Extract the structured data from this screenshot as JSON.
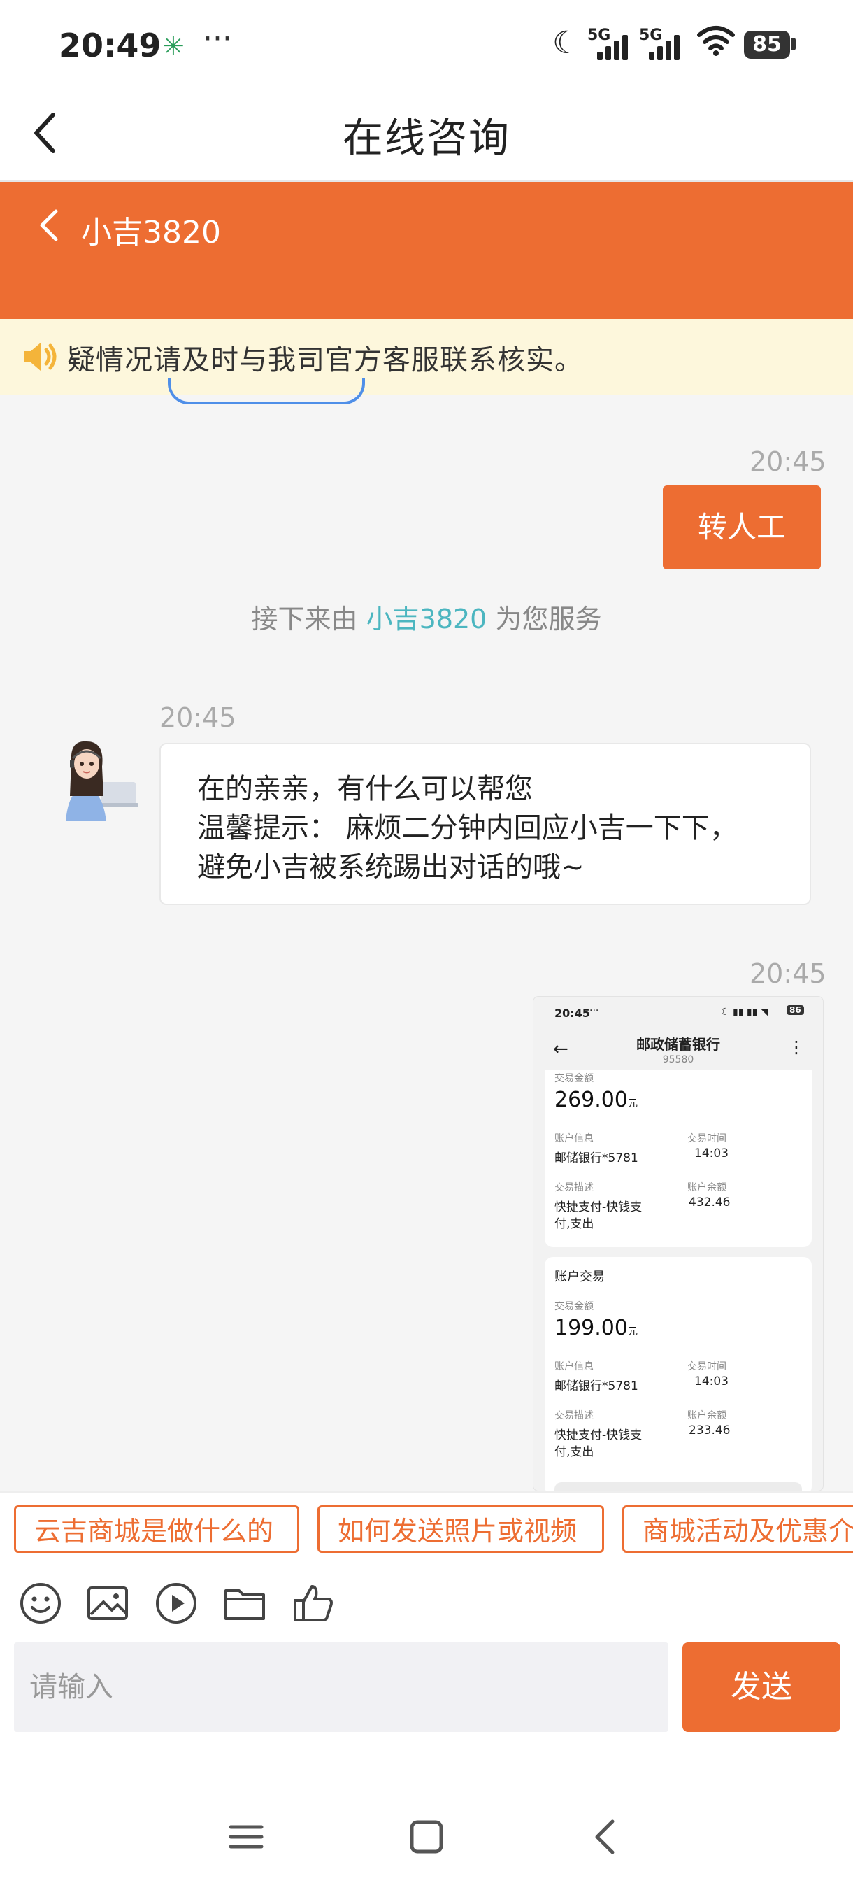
{
  "status_bar": {
    "time": "20:49",
    "notif_icon": "china-post-icon",
    "dots": "···",
    "signal_tags": [
      "5G",
      "5G"
    ],
    "battery": "85"
  },
  "title_bar": {
    "title": "在线咨询"
  },
  "chat_header": {
    "agent_name": "小吉3820"
  },
  "notice": {
    "text": "疑情况请及时与我司官方客服联系核实。"
  },
  "messages": {
    "m1_time": "20:45",
    "m1_text": "转人工",
    "system_prefix": "接下来由",
    "system_agent": "小吉3820",
    "system_suffix": "为您服务",
    "m2_time": "20:45",
    "m2_lines": [
      "在的亲亲，有什么可以帮您",
      "温馨提示： 麻烦二分钟内回应小吉一下下，",
      "避免小吉被系统踢出对话的哦~"
    ],
    "m3_time": "20:45"
  },
  "screenshot": {
    "time": "20:45",
    "dots": "···",
    "battery": "86",
    "bank": "邮政储蓄银行",
    "bank_number": "95580",
    "tx1": {
      "amount_label": "交易金额",
      "amount": "269.00",
      "unit": "元",
      "account_label": "账户信息",
      "account": "邮储银行*5781",
      "time_label": "交易时间",
      "time": "14:03",
      "desc_label": "交易描述",
      "desc_1": "快捷支付-快钱支",
      "desc_2": "付,支出",
      "balance_label": "账户余额",
      "balance": "432.46"
    },
    "tx2": {
      "header": "账户交易",
      "amount_label": "交易金额",
      "amount": "199.00",
      "unit": "元",
      "account_label": "账户信息",
      "account": "邮储银行*5781",
      "time_label": "交易时间",
      "time": "14:03",
      "desc_label": "交易描述",
      "desc_1": "快捷支付-快钱支",
      "desc_2": "付,支出",
      "balance_label": "账户余额",
      "balance": "233.46"
    }
  },
  "quick_replies": [
    "云吉商城是做什么的",
    "如何发送照片或视频",
    "商城活动及优惠介"
  ],
  "toolbar_icons": [
    "emoji-icon",
    "image-icon",
    "video-icon",
    "folder-icon",
    "thumbs-up-icon"
  ],
  "composer": {
    "placeholder": "请输入",
    "send_label": "发送"
  },
  "colors": {
    "accent": "#ed6d32",
    "agent_link": "#4cb6c0",
    "notice_bg": "#fdf7dc"
  }
}
